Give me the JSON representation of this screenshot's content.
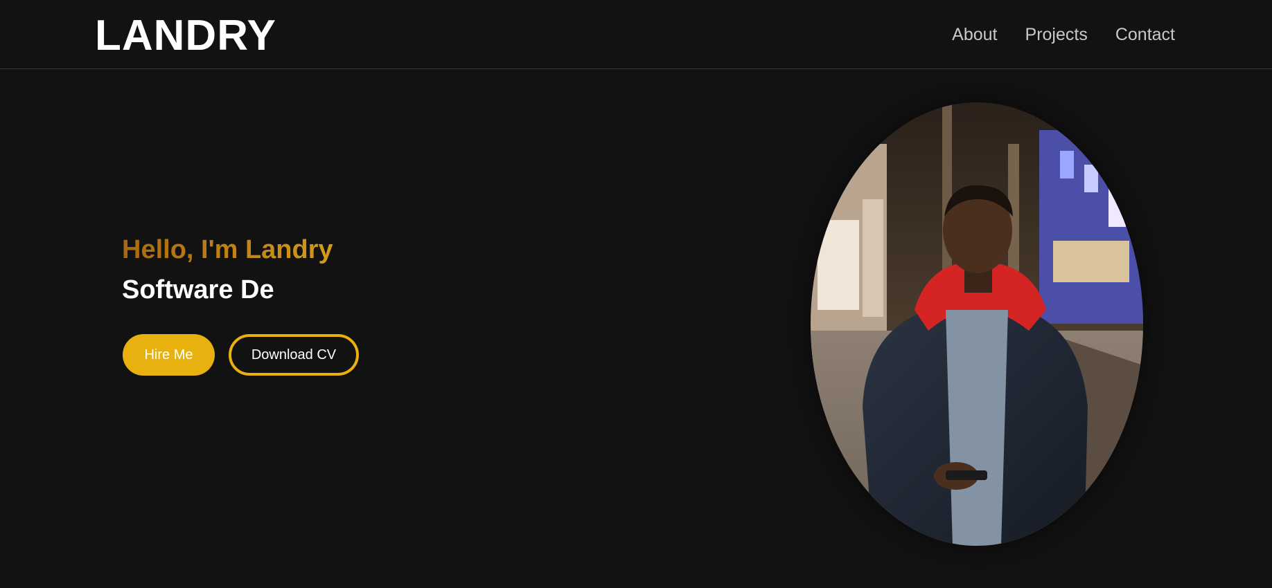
{
  "header": {
    "logo": "LANDRY",
    "nav": [
      {
        "label": "About"
      },
      {
        "label": "Projects"
      },
      {
        "label": "Contact"
      }
    ]
  },
  "hero": {
    "greeting": "Hello, I'm Landry",
    "role_typed": "Software De",
    "buttons": {
      "primary": "Hire Me",
      "secondary": "Download CV"
    }
  },
  "colors": {
    "background": "#121212",
    "accent": "#e9b10f",
    "greeting_gradient_start": "#a8690f",
    "greeting_gradient_end": "#d49b1a"
  }
}
